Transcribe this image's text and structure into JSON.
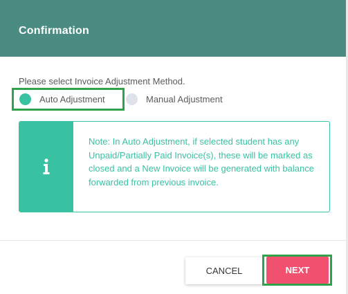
{
  "dialog": {
    "title": "Confirmation",
    "prompt": "Please select Invoice Adjustment Method.",
    "options": [
      {
        "label": "Auto Adjustment",
        "selected": true
      },
      {
        "label": "Manual Adjustment",
        "selected": false
      }
    ],
    "note": {
      "icon": "info-icon",
      "text": "Note: In Auto Adjustment, if selected student has any Unpaid/Partially Paid Invoice(s), these will be marked as closed and a New Invoice will be generated with balance forwarded from previous invoice."
    },
    "buttons": {
      "cancel": "CANCEL",
      "next": "NEXT"
    }
  },
  "colors": {
    "header": "#4a8c82",
    "accent": "#38c2a1",
    "primary_button": "#f1516e",
    "highlight_outline": "#2fa24a"
  }
}
